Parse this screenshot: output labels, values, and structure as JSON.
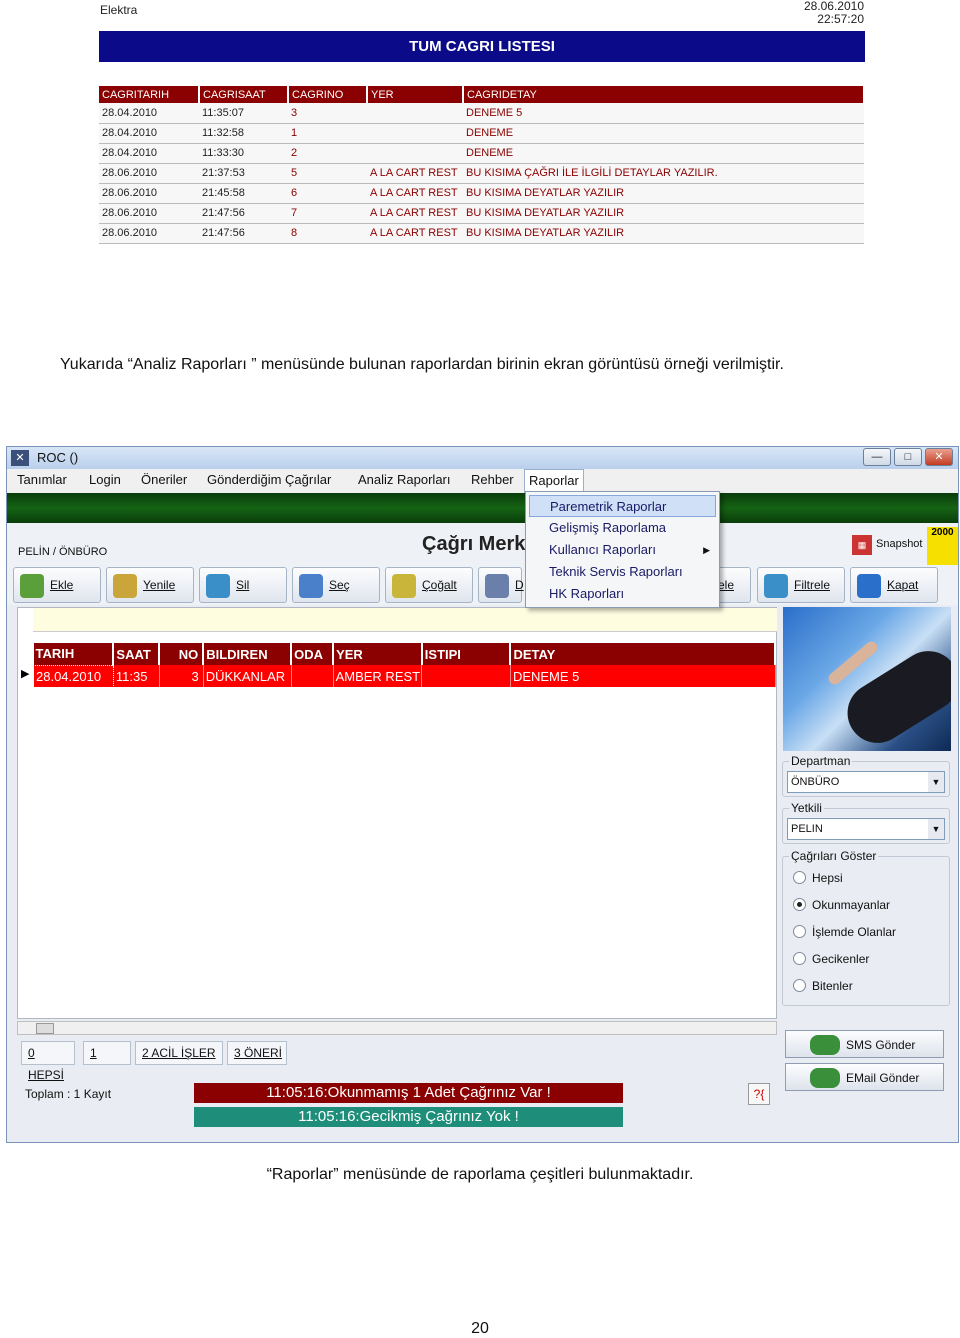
{
  "report": {
    "app_name": "Elektra",
    "date": "28.06.2010",
    "time": "22:57:20",
    "title": "TUM CAGRI LISTESI",
    "columns": [
      "CAGRITARIH",
      "CAGRISAAT",
      "CAGRINO",
      "YER",
      "CAGRIDETAY"
    ],
    "rows": [
      [
        "28.04.2010",
        "11:35:07",
        "3",
        "",
        "DENEME 5"
      ],
      [
        "28.04.2010",
        "11:32:58",
        "1",
        "",
        "DENEME"
      ],
      [
        "28.04.2010",
        "11:33:30",
        "2",
        "",
        "DENEME"
      ],
      [
        "28.06.2010",
        "21:37:53",
        "5",
        "A LA CART REST",
        "BU KISIMA ÇAĞRI İLE İLGİLİ DETAYLAR YAZILIR."
      ],
      [
        "28.06.2010",
        "21:45:58",
        "6",
        "A LA CART REST",
        "BU KISIMA DEYATLAR YAZILIR"
      ],
      [
        "28.06.2010",
        "21:47:56",
        "7",
        "A LA CART REST",
        "BU KISIMA DEYATLAR YAZILIR"
      ],
      [
        "28.06.2010",
        "21:47:56",
        "8",
        "A LA CART REST",
        "BU KISIMA DEYATLAR YAZILIR"
      ]
    ]
  },
  "caption1": "Yukarıda “Analiz Raporları ” menüsünde bulunan raporlardan birinin ekran görüntüsü örneği verilmiştir.",
  "caption2": "“Raporlar” menüsünde de raporlama çeşitleri bulunmaktadır.",
  "page_number": "20",
  "window": {
    "title": "ROC ()",
    "menus": [
      "Tanımlar",
      "Login",
      "Öneriler",
      "Gönderdiğim Çağrılar",
      "Analiz Raporları",
      "Rehber",
      "Raporlar"
    ],
    "dropdown": [
      "Paremetrik Raporlar",
      "Gelişmiş Raporlama",
      "Kullanıcı Raporları",
      "Teknik Servis Raporları",
      "HK Raporları"
    ],
    "user_label": "PELİN / ÖNBÜRO",
    "form_title": "Çağrı Merke",
    "snapshot_label": "Snapshot",
    "flag_text": "2000",
    "toolbar": [
      "Ekle",
      "Yenile",
      "Sil",
      "Seç",
      "Çoğalt",
      "D",
      "ele",
      "Filtrele",
      "Kapat"
    ],
    "grid": {
      "columns": [
        "TARIH",
        "SAAT",
        "NO",
        "BILDIREN",
        "ODA",
        "YER",
        "ISTIPI",
        "DETAY"
      ],
      "rows": [
        [
          "28.04.2010",
          "11:35",
          "3",
          "DÜKKANLAR",
          "",
          "AMBER REST",
          "",
          "DENEME 5"
        ]
      ]
    },
    "tabs": [
      "0 HEPSİ",
      "1",
      "2 ACİL İŞLER",
      "3 ÖNERİ"
    ],
    "total": "Toplam : 1 Kayıt",
    "message1": "11:05:16:Okunmamış 1 Adet Çağrınız Var !",
    "message2": "11:05:16:Gecikmiş Çağrınız Yok !",
    "departman_label": "Departman",
    "departman_value": "ÖNBÜRO",
    "yetkili_label": "Yetkili",
    "yetkili_value": "PELIN",
    "show_label": "Çağrıları Göster",
    "radios": [
      "Hepsi",
      "Okunmayanlar",
      "İşlemde Olanlar",
      "Gecikenler",
      "Bitenler"
    ],
    "radio_selected": "Okunmayanlar",
    "sms_button": "SMS Gönder",
    "email_button": "EMail Gönder",
    "help_icon": "?{"
  }
}
